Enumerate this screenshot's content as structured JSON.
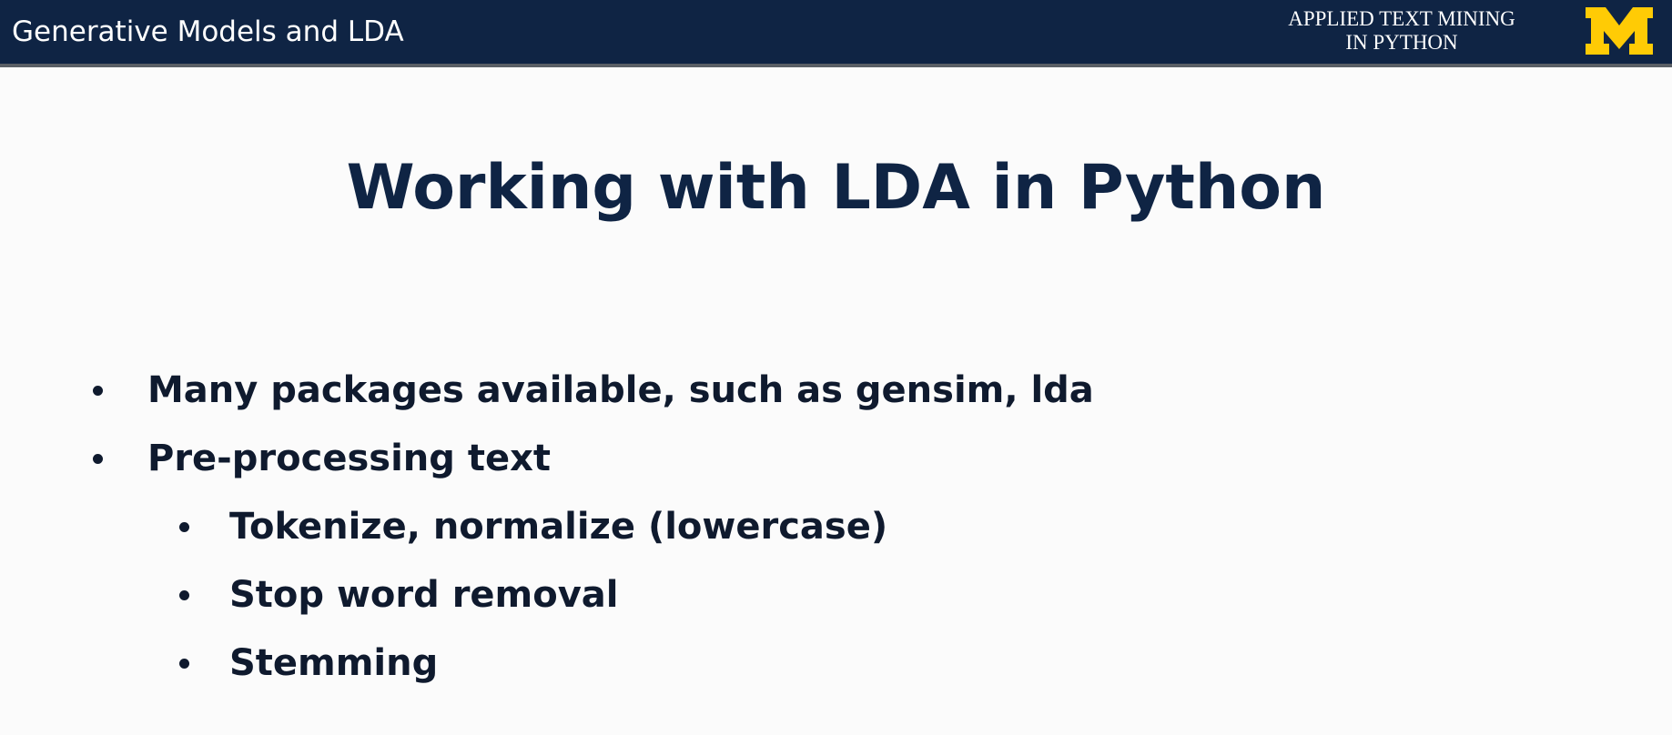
{
  "header": {
    "section_title": "Generative Models and LDA",
    "course_line1": "APPLIED TEXT MINING",
    "course_line2": "IN PYTHON",
    "logo_letter": "M",
    "bar_color": "#0f2444",
    "logo_color": "#ffcb05"
  },
  "slide": {
    "title": "Working with LDA in Python",
    "bullets": [
      {
        "text": "Many packages available, such as gensim, lda",
        "level": 1
      },
      {
        "text": "Pre-processing text",
        "level": 1
      },
      {
        "text": "Tokenize, normalize (lowercase)",
        "level": 2
      },
      {
        "text": "Stop word removal",
        "level": 2
      },
      {
        "text": "Stemming",
        "level": 2
      }
    ]
  }
}
